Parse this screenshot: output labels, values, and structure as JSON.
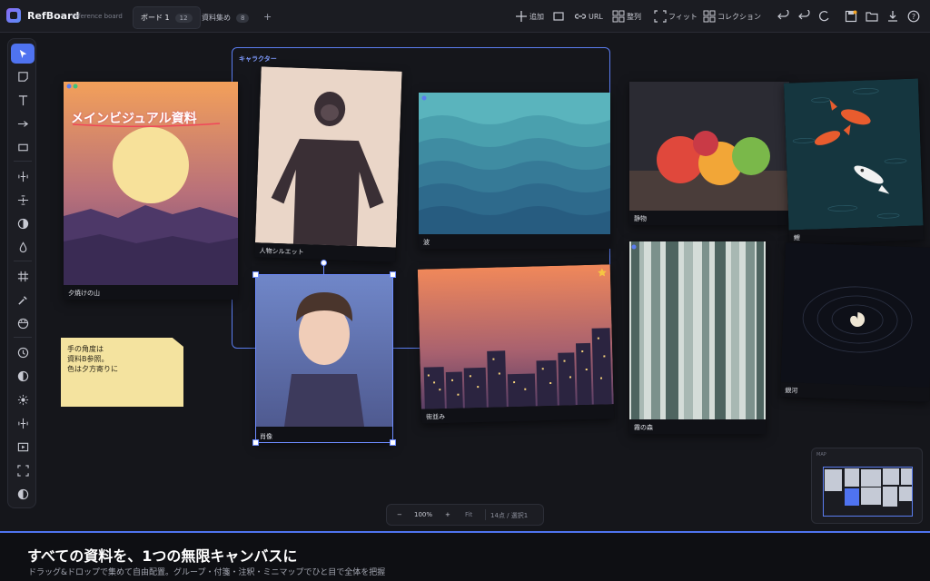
{
  "app": {
    "name": "RefBoard",
    "subtitle": "reference board"
  },
  "tabs": [
    {
      "label": "ボード 1",
      "count": "12",
      "active": true
    },
    {
      "label": "資料集め",
      "count": "8",
      "active": false
    }
  ],
  "toolbar_top": {
    "add_label": "追加",
    "url_label": "URL",
    "arrange_label": "整列",
    "fit_label": "フィット",
    "collection_label": "コレクション"
  },
  "canvas": {
    "group_label": "キャラクター",
    "cards": {
      "sunset_mountains": {
        "caption": "夕焼けの山",
        "overlay_text": "メインビジュアル資料"
      },
      "silhouette": {
        "caption": "人物シルエット"
      },
      "waves": {
        "caption": "波"
      },
      "portrait": {
        "caption": "肖像"
      },
      "city": {
        "caption": "街並み"
      },
      "still_life": {
        "caption": "静物"
      },
      "carp": {
        "caption": "鯉"
      },
      "forest": {
        "caption": "霧の森"
      },
      "galaxy": {
        "caption": "銀河"
      }
    },
    "sticky_note": {
      "line1": "手の角度は",
      "line2": "資料B参照。",
      "line3": "色は夕方寄りに"
    }
  },
  "minimap": {
    "label": "MAP"
  },
  "zoom": {
    "minus": "−",
    "level": "100%",
    "plus": "+",
    "fit": "Fit",
    "status": "14点 / 選択1"
  },
  "footer": {
    "title": "すべての資料を、1つの無限キャンバスに",
    "subtitle": "ドラッグ&ドロップで集めて自由配置。グループ・付箋・注釈・ミニマップでひと目で全体を把握"
  },
  "colors": {
    "accent": "#4f73f0",
    "background": "#15161b",
    "sticky": "#f4e39f",
    "annotation": "#f0465a"
  },
  "icons": [
    "select-icon",
    "note-icon",
    "text-icon",
    "arrow-icon",
    "rect-icon",
    "align-h-icon",
    "align-v-icon",
    "contrast-icon",
    "drop-icon",
    "grid-icon",
    "eyedropper-icon",
    "palette-icon",
    "clock-icon",
    "invert-icon",
    "brightness-icon",
    "flip-icon",
    "play-icon",
    "fullscreen-icon",
    "half-circle-icon"
  ]
}
